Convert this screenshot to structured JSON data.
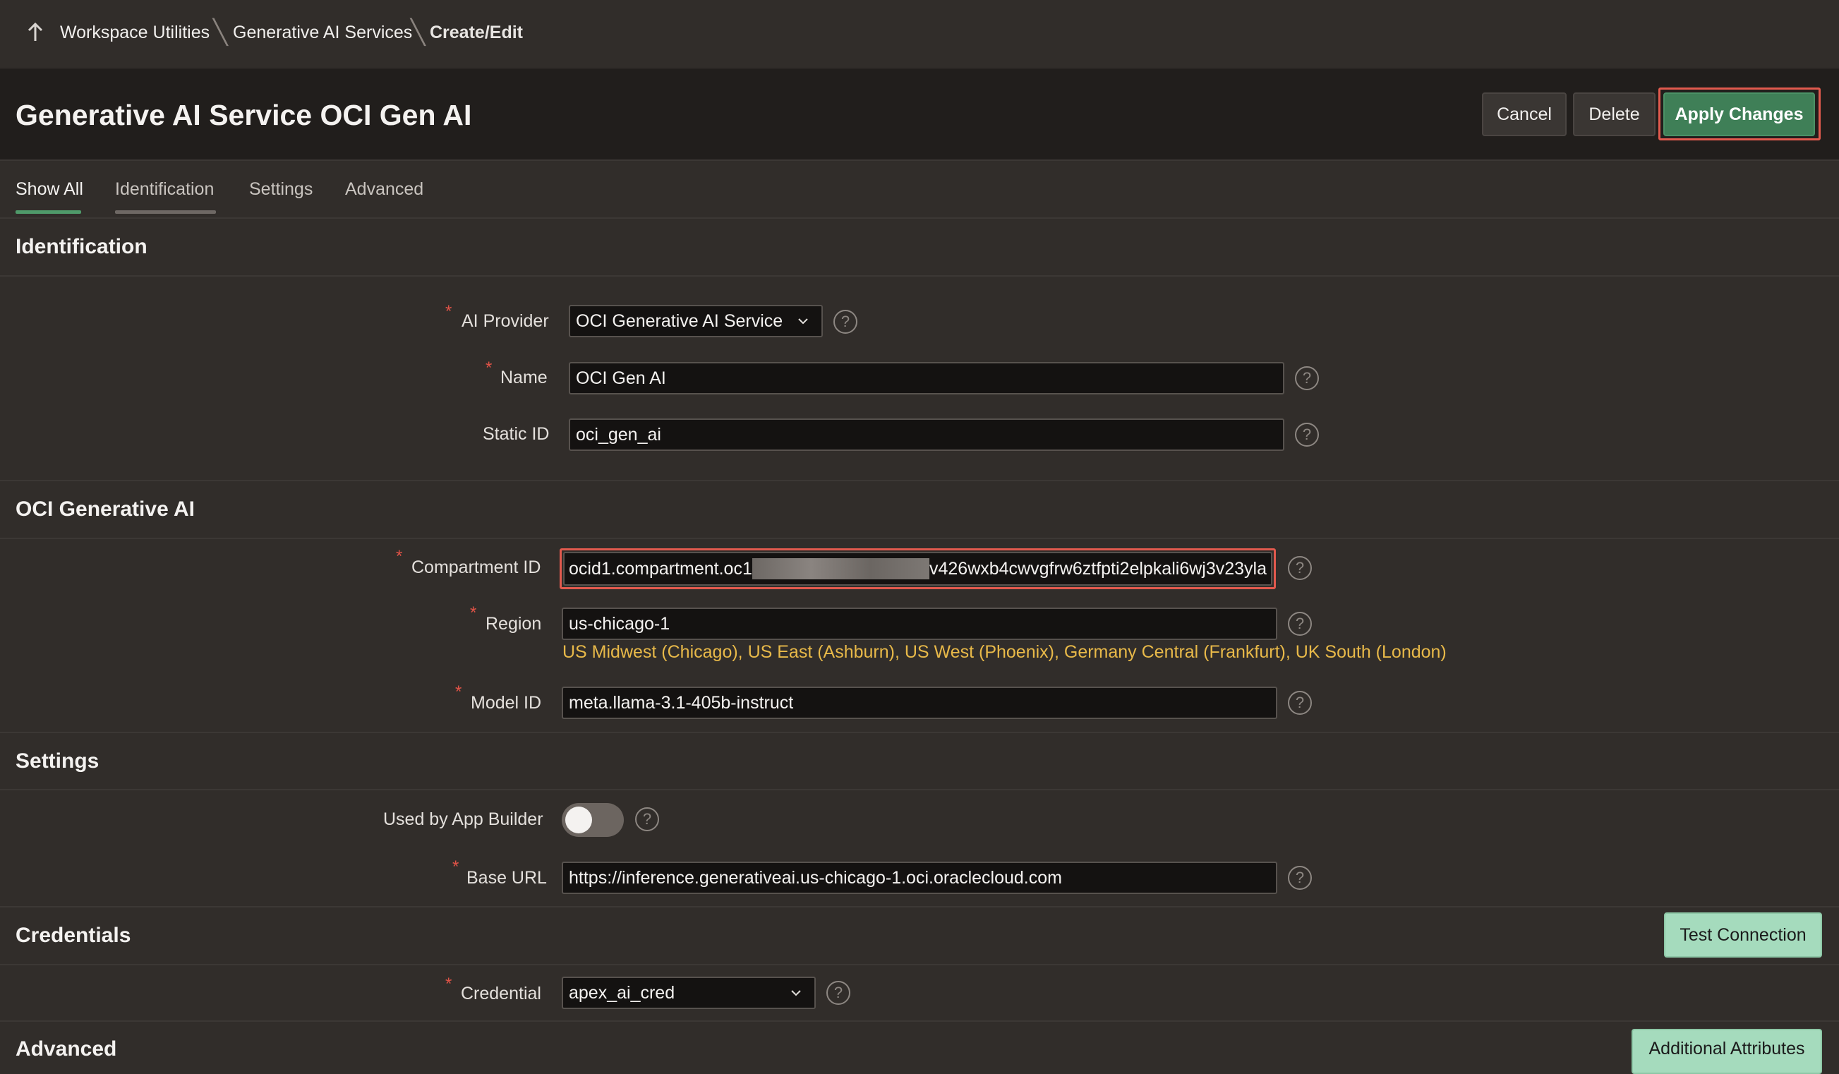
{
  "breadcrumb": {
    "items": [
      "Workspace Utilities",
      "Generative AI Services",
      "Create/Edit"
    ]
  },
  "header": {
    "title": "Generative AI Service OCI Gen AI",
    "buttons": {
      "cancel": "Cancel",
      "delete": "Delete",
      "apply": "Apply Changes"
    }
  },
  "tabs": [
    "Show All",
    "Identification",
    "Settings",
    "Advanced"
  ],
  "sections": {
    "identification": "Identification",
    "oci": "OCI Generative AI",
    "settings": "Settings",
    "credentials": "Credentials",
    "advanced": "Advanced"
  },
  "identification": {
    "ai_provider": {
      "label": "AI Provider",
      "value": "OCI Generative AI Service"
    },
    "name": {
      "label": "Name",
      "value": "OCI Gen AI"
    },
    "static_id": {
      "label": "Static ID",
      "value": "oci_gen_ai"
    }
  },
  "oci": {
    "compartment_id": {
      "label": "Compartment ID",
      "value_start": "ocid1.compartment.oc1",
      "value_end": "v426wxb4cwvgfrw6ztfpti2elpkali6wj3v23yla"
    },
    "region": {
      "label": "Region",
      "value": "us-chicago-1",
      "hint": "US Midwest (Chicago), US East (Ashburn), US West (Phoenix), Germany Central (Frankfurt), UK South (London)"
    },
    "model_id": {
      "label": "Model ID",
      "value": "meta.llama-3.1-405b-instruct"
    }
  },
  "settings": {
    "used_by_app_builder": {
      "label": "Used by App Builder",
      "on": false
    },
    "base_url": {
      "label": "Base URL",
      "value": "https://inference.generativeai.us-chicago-1.oci.oraclecloud.com"
    }
  },
  "credentials": {
    "test_connection": "Test Connection",
    "credential": {
      "label": "Credential",
      "value": "apex_ai_cred"
    }
  },
  "advanced": {
    "additional_attributes": "Additional Attributes"
  },
  "common": {
    "required_mark": "*",
    "help_mark": "?"
  },
  "colors": {
    "accent_green": "#3f7f57",
    "highlight_red": "#e15a4e",
    "hint_yellow": "#e8b949"
  }
}
